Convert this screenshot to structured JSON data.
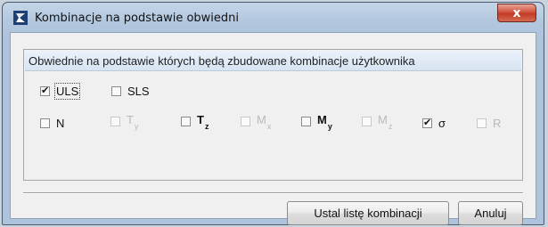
{
  "window": {
    "title": "Kombinacje na podstawie obwiedni",
    "close_label": "x"
  },
  "group": {
    "title": "Obwiednie na podstawie których będą zbudowane kombinacje użytkownika"
  },
  "row1": [
    {
      "label": "ULS",
      "checked": true,
      "enabled": true
    },
    {
      "label": "SLS",
      "checked": false,
      "enabled": true
    }
  ],
  "row2": [
    {
      "base": "N",
      "sub": "",
      "checked": false,
      "enabled": true
    },
    {
      "base": "T",
      "sub": "y",
      "checked": false,
      "enabled": false
    },
    {
      "base": "T",
      "sub": "z",
      "checked": false,
      "enabled": true
    },
    {
      "base": "M",
      "sub": "x",
      "checked": false,
      "enabled": false
    },
    {
      "base": "M",
      "sub": "y",
      "checked": false,
      "enabled": true
    },
    {
      "base": "M",
      "sub": "z",
      "checked": false,
      "enabled": false
    },
    {
      "base": "σ",
      "sub": "",
      "checked": true,
      "enabled": true
    },
    {
      "base": "R",
      "sub": "",
      "checked": false,
      "enabled": false
    }
  ],
  "buttons": {
    "ok": "Ustal listę kombinacji",
    "cancel": "Anuluj"
  },
  "colors": {
    "titlebar": "#b3c8df",
    "close": "#c23a25",
    "client": "#f0f0f0",
    "group_header": "#d7e4f2"
  }
}
